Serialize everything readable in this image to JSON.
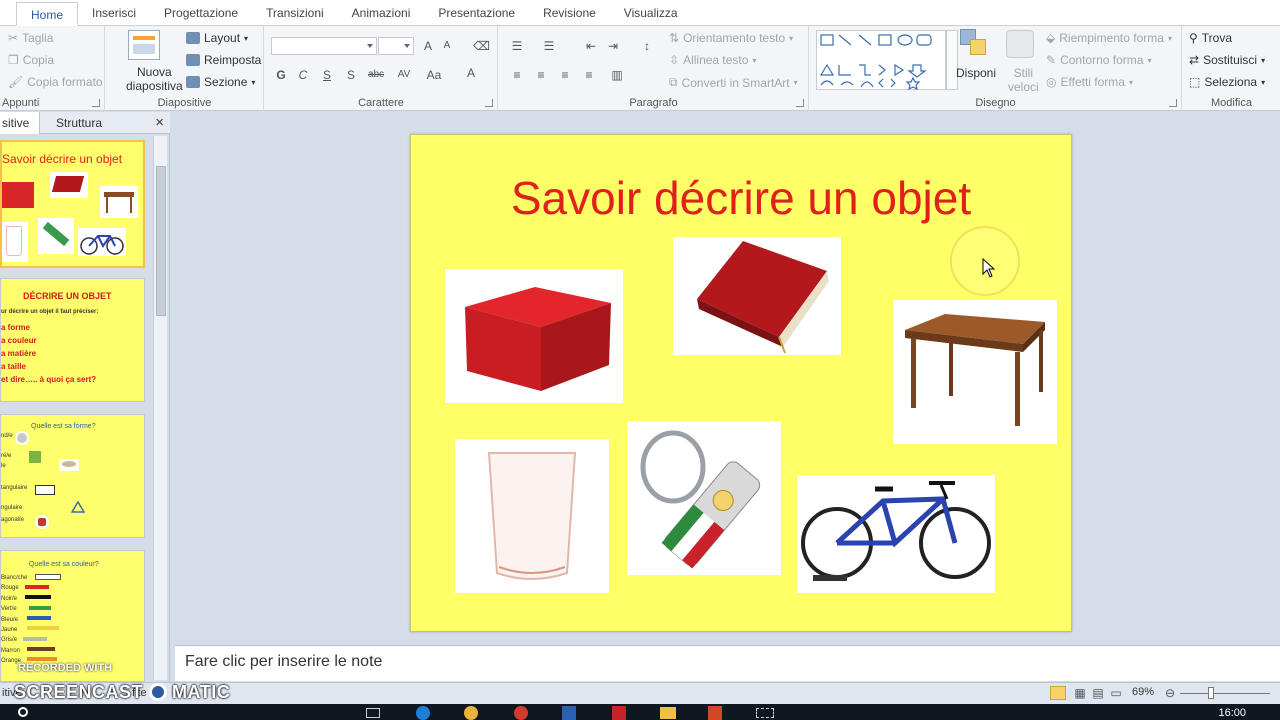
{
  "tabs": [
    "Home",
    "Inserisci",
    "Progettazione",
    "Transizioni",
    "Animazioni",
    "Presentazione",
    "Revisione",
    "Visualizza"
  ],
  "clipboard": {
    "cut": "Taglia",
    "copy": "Copia",
    "format_painter": "Copia formato",
    "label": "Appunti"
  },
  "slides_group": {
    "new_slide_1": "Nuova",
    "new_slide_2": "diapositiva",
    "layout": "Layout",
    "reset": "Reimposta",
    "section": "Sezione",
    "label": "Diapositive"
  },
  "font_group": {
    "label": "Carattere",
    "bold": "G",
    "italic": "C",
    "underline": "S",
    "shadow": "S",
    "strike": "abc",
    "spacing": "AV",
    "case": "Aa"
  },
  "paragraph_group": {
    "label": "Paragrafo",
    "text_direction": "Orientamento testo",
    "align_text": "Allinea testo",
    "smartart": "Converti in SmartArt"
  },
  "drawing_group": {
    "label": "Disegno",
    "arrange": "Disponi",
    "styles_1": "Stili",
    "styles_2": "veloci",
    "fill": "Riempimento forma",
    "outline": "Contorno forma",
    "effects": "Effetti forma"
  },
  "editing_group": {
    "label": "Modifica",
    "find": "Trova",
    "replace": "Sostituisci",
    "select": "Seleziona"
  },
  "panel": {
    "tab_slides": "sitive",
    "tab_outline": "Struttura",
    "close": "×"
  },
  "thumbs": {
    "t1_title": "Savoir décrire un objet",
    "t2_title": "DÉCRIRE UN OBJET",
    "t2_intro": "ur décrire un objet il faut préciser:",
    "t2_items": [
      "a forme",
      "a couleur",
      "a matière",
      "a taille",
      "et dire….. à quoi ça sert?"
    ],
    "t3_title": "Quelle est sa forme?",
    "t3_items": [
      "nd/e",
      "ré/e",
      "le",
      "tangulaire",
      "ngulaire",
      "agonal/e"
    ],
    "t4_title": "Quelle est sa couleur?",
    "t4_items": [
      "Blanc/che",
      "Rouge",
      "Noir/e",
      "Vert/e",
      "Bleu/e",
      "Jaune",
      "Gris/e",
      "Marron",
      "Orange"
    ]
  },
  "slide": {
    "title": "Savoir décrire un objet"
  },
  "notes": {
    "placeholder": "Fare clic per inserire le note"
  },
  "status": {
    "left": "itive",
    "left2": "fite",
    "zoom": "69%"
  },
  "taskbar": {
    "clock": "16:00"
  },
  "watermark": {
    "line1": "RECORDED WITH",
    "line2": "SCREENCAST",
    "line3": "MATIC"
  },
  "colors": {
    "accent": "#2a5aa0",
    "slide_bg": "#ffff66",
    "title_red": "#e0201a",
    "thumb_selected": "#f5c14b"
  }
}
